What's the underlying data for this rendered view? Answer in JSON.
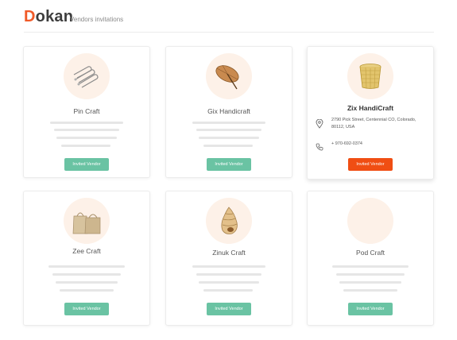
{
  "header": {
    "logo_first": "D",
    "logo_rest": "okan",
    "subtitle": "Vendors invitations"
  },
  "vendors": [
    {
      "name": "Pin Craft",
      "button": "Invited Vendor",
      "image": "safety-pins-icon"
    },
    {
      "name": "Gix Handicraft",
      "button": "Invited Vendor",
      "image": "umbrella-icon"
    },
    {
      "name": "Zix HandiCraft",
      "button": "Invited Vendor",
      "image": "basket-icon",
      "address": "2790 Pick Street, Centennial CO, Colorado, 80112, USA",
      "phone": "+ 970-692-0374"
    },
    {
      "name": "Zee Craft",
      "button": "Invited Vendor",
      "image": "bags-icon"
    },
    {
      "name": "Zinuk Craft",
      "button": "Invited Vendor",
      "image": "seashell-icon"
    },
    {
      "name": "Pod Craft",
      "button": "Invited Vendor",
      "image": "empty-avatar"
    }
  ],
  "colors": {
    "accent": "#f04e13",
    "button": "#6ac3a3",
    "avatar_bg": "#fdf1e8"
  }
}
